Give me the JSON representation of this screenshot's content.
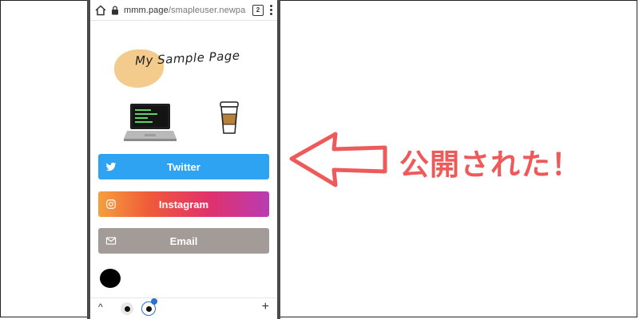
{
  "browser": {
    "url_main": "mmm.page",
    "url_path": "/smapleuser.newpa",
    "tab_count": "2"
  },
  "page": {
    "title": "My Sample Page",
    "links": [
      {
        "label": "Twitter",
        "icon": "twitter-icon",
        "color": "#2ea3f2"
      },
      {
        "label": "Instagram",
        "icon": "instagram-icon",
        "color": "#e0316b"
      },
      {
        "label": "Email",
        "icon": "mail-icon",
        "color": "#a29b98"
      }
    ]
  },
  "bottom_bar": {
    "up": "^",
    "new_tab": "+"
  },
  "annotation": {
    "caption": "公開された！",
    "color": "#ee5a5a"
  }
}
